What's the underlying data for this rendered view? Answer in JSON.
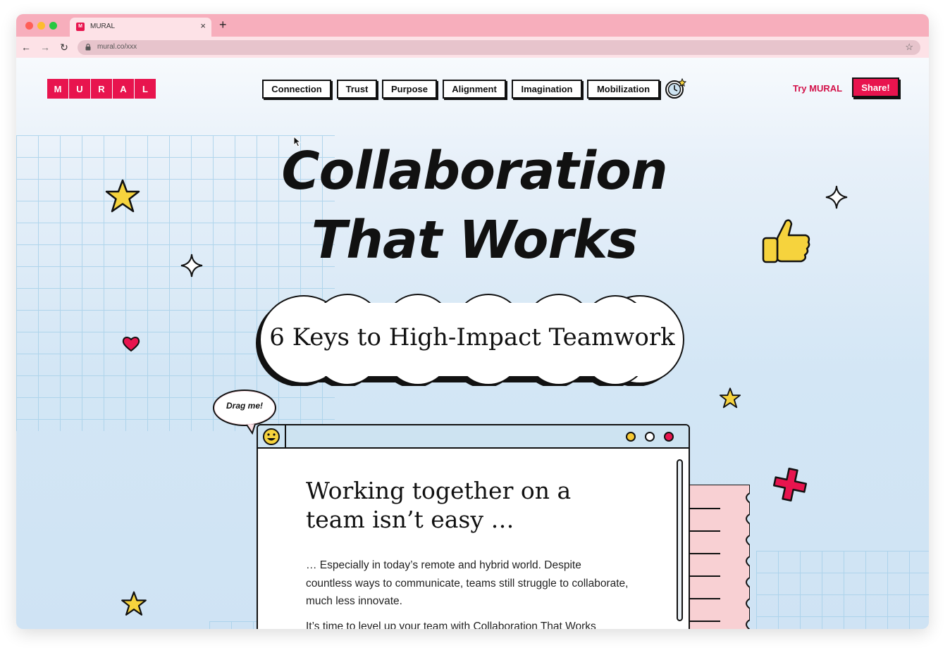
{
  "browser": {
    "tab_title": "MURAL",
    "tab_favicon": "M",
    "close_glyph": "×",
    "new_tab_glyph": "+",
    "back_glyph": "←",
    "forward_glyph": "→",
    "reload_glyph": "↻",
    "bookmark_glyph": "☆",
    "url": "mural.co/xxx"
  },
  "logo_letters": [
    "M",
    "U",
    "R",
    "A",
    "L"
  ],
  "nav": {
    "items": [
      "Connection",
      "Trust",
      "Purpose",
      "Alignment",
      "Imagination",
      "Mobilization"
    ],
    "try_label": "Try MURAL",
    "share_label": "Share!"
  },
  "hero": {
    "title_line1": "Collaboration",
    "title_line2": "That Works",
    "subtitle": "6 Keys to High-Impact Teamwork",
    "drag_label": "Drag me!"
  },
  "window": {
    "heading": "Working together on a team isn’t easy …",
    "body": "… Especially in today’s remote and hybrid world. Despite countless ways to communicate, teams still struggle to collaborate, much less innovate.",
    "body2": "It’s time to level up your team with Collaboration That Works"
  },
  "colors": {
    "brand": "#e8144e",
    "titlebar": "#f7aebc",
    "star": "#f6d33d",
    "page_bg": "#d3e6f5"
  },
  "icons": [
    "star-icon",
    "sparkle-icon",
    "heart-icon",
    "thumbs-up-icon",
    "plus-icon",
    "timer-icon",
    "smiley-icon",
    "lock-icon"
  ]
}
